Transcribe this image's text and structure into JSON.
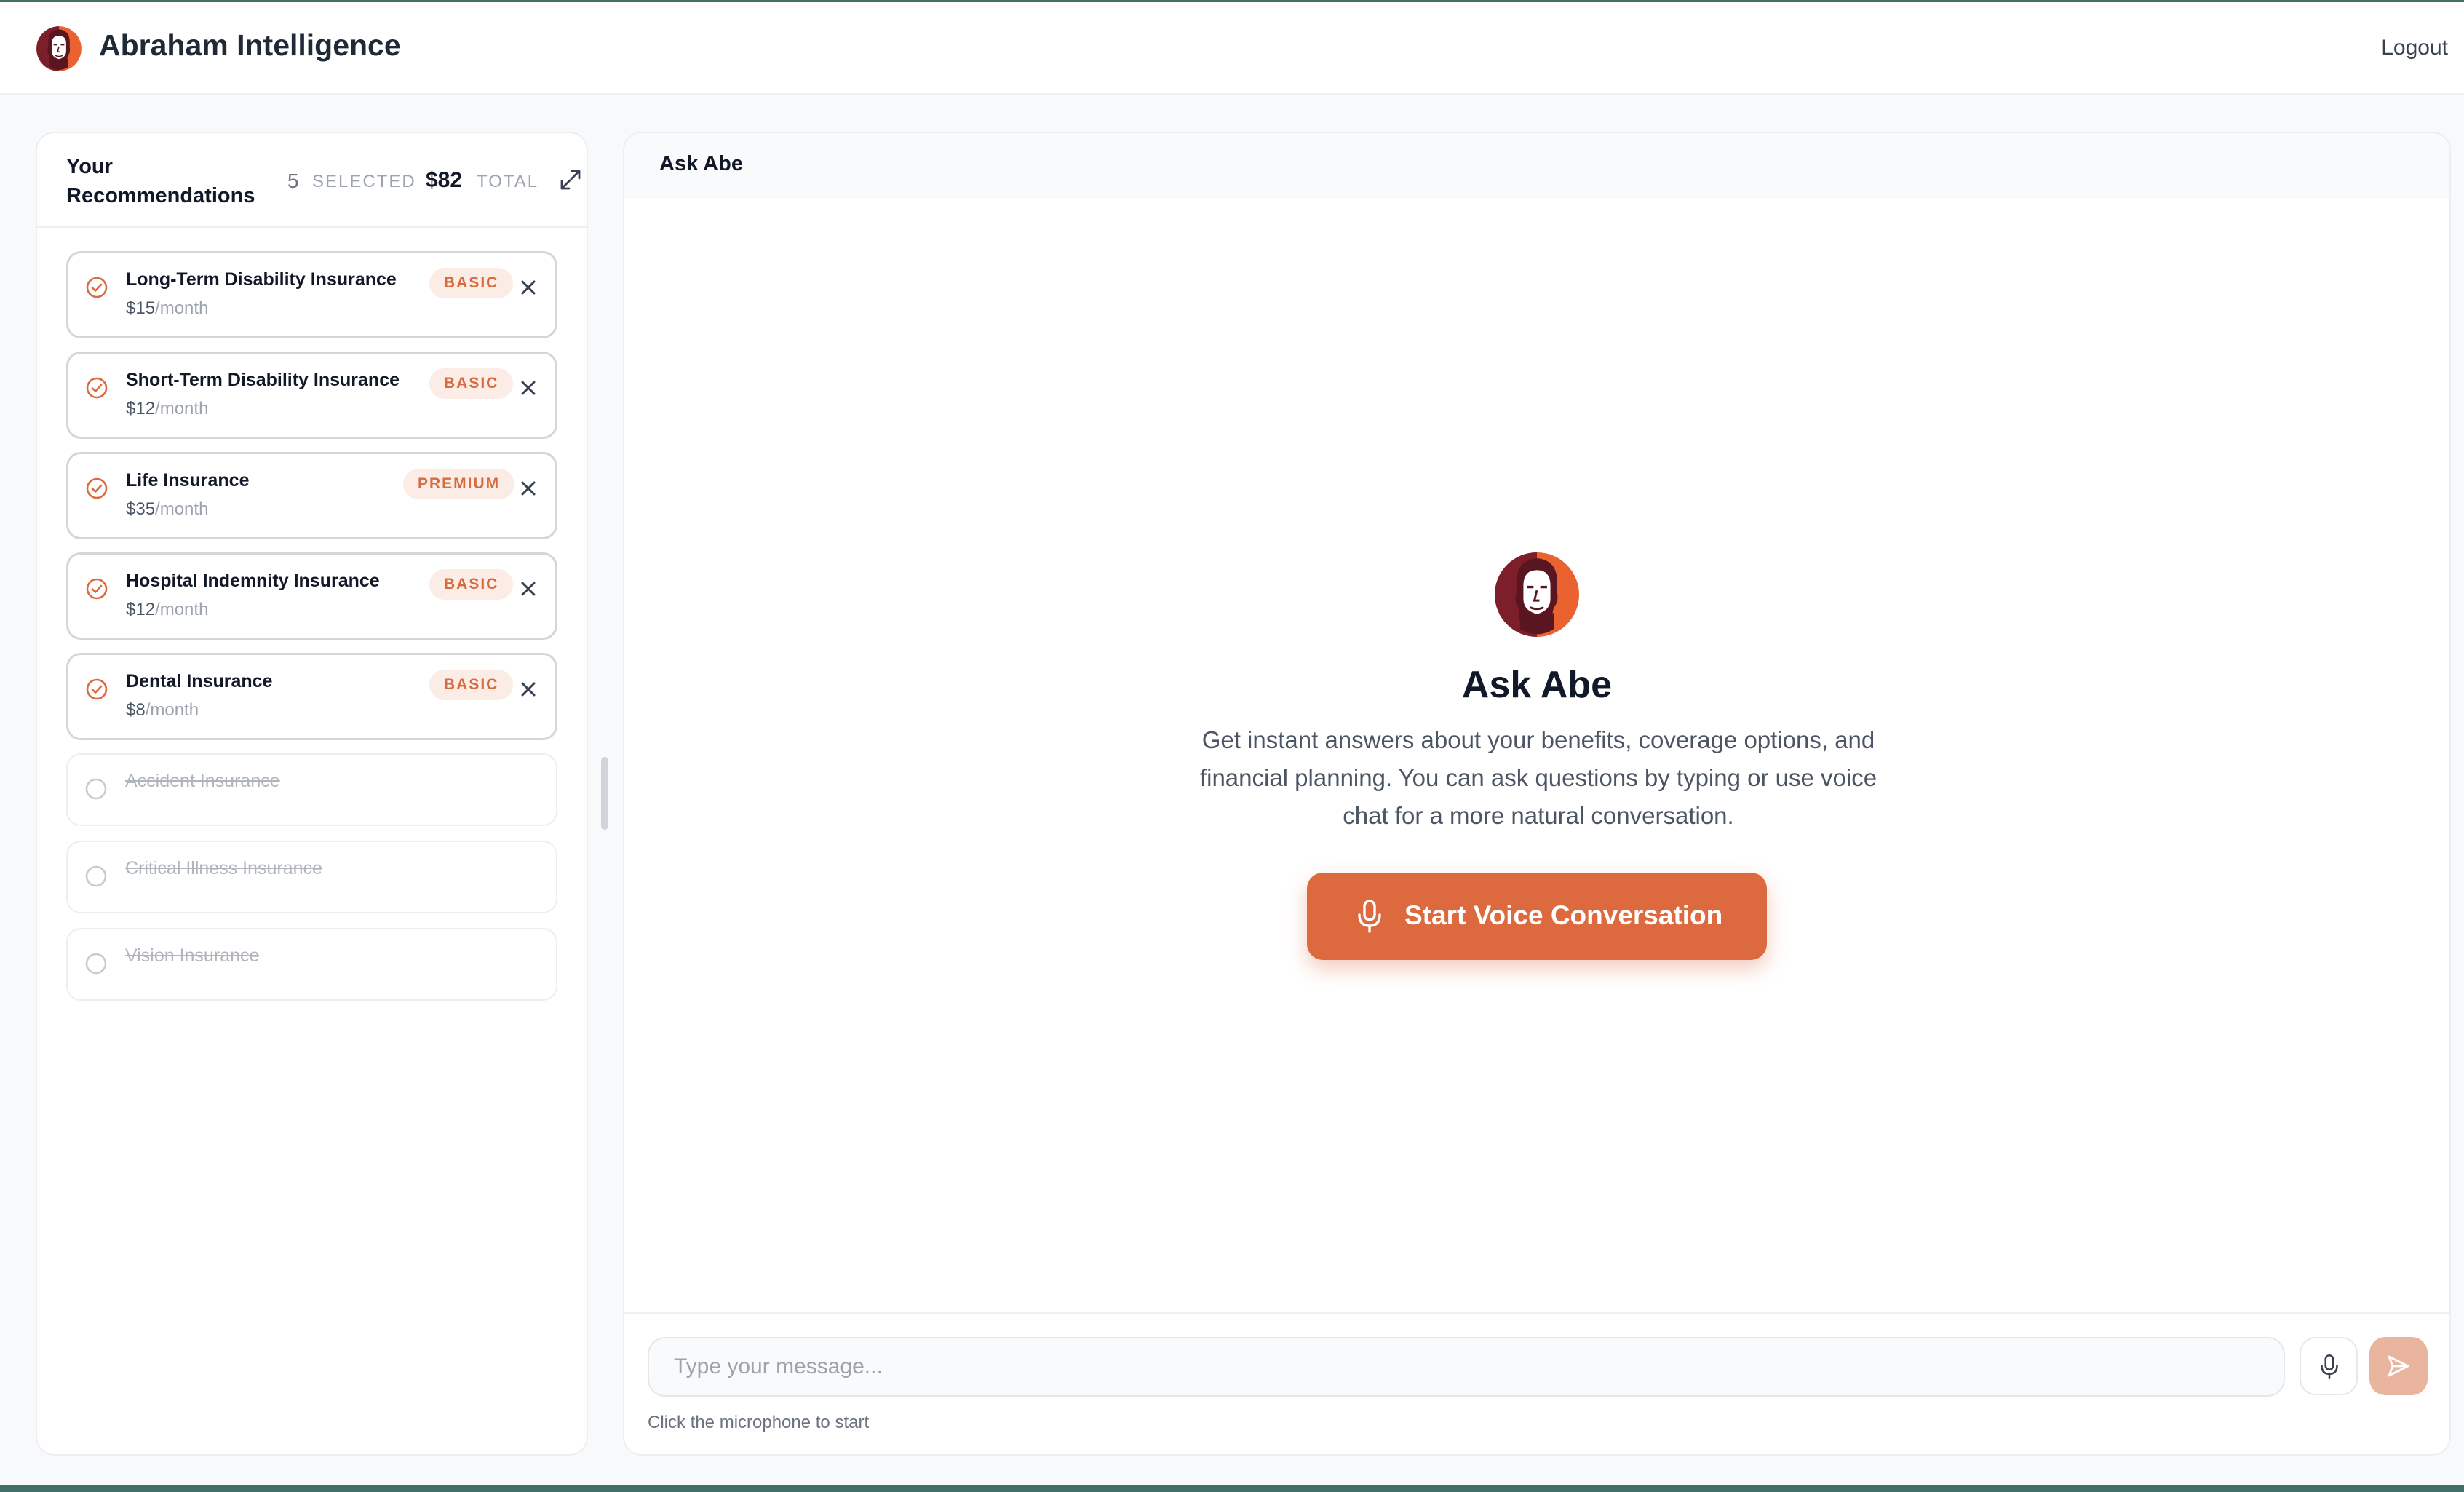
{
  "header": {
    "app_title": "Abraham Intelligence",
    "logout_label": "Logout"
  },
  "recommendations": {
    "title": "Your Recommendations",
    "selected_count": "5",
    "selected_label": "SELECTED",
    "total": "$82",
    "total_label": "TOTAL",
    "per_month": "/month",
    "items": [
      {
        "name": "Long-Term Disability Insurance",
        "price": "$15",
        "badge": "BASIC",
        "selected": true
      },
      {
        "name": "Short-Term Disability Insurance",
        "price": "$12",
        "badge": "BASIC",
        "selected": true
      },
      {
        "name": "Life Insurance",
        "price": "$35",
        "badge": "PREMIUM",
        "selected": true
      },
      {
        "name": "Hospital Indemnity Insurance",
        "price": "$12",
        "badge": "BASIC",
        "selected": true
      },
      {
        "name": "Dental Insurance",
        "price": "$8",
        "badge": "BASIC",
        "selected": true
      },
      {
        "name": "Accident Insurance",
        "selected": false
      },
      {
        "name": "Critical Illness Insurance",
        "selected": false
      },
      {
        "name": "Vision Insurance",
        "selected": false
      }
    ]
  },
  "chat": {
    "title": "Ask Abe",
    "hero_title": "Ask Abe",
    "hero_description": "Get instant answers about your benefits, coverage options, and financial planning. You can ask questions by typing or use voice chat for a more natural conversation.",
    "voice_button_label": "Start Voice Conversation",
    "input_placeholder": "Type your message...",
    "hint": "Click the microphone to start"
  },
  "colors": {
    "accent": "#dc6a3e",
    "badge_bg": "#fbece6",
    "send_disabled": "#eab59f",
    "frame": "#3f6f66"
  },
  "icons": {
    "logo": "abe-lincoln-logo",
    "expand": "expand-icon",
    "check": "check-circle-icon",
    "remove": "close-icon",
    "mic": "microphone-icon",
    "send": "send-icon"
  }
}
